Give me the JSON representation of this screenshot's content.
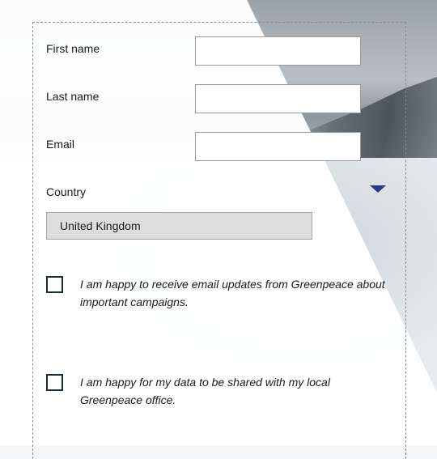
{
  "form": {
    "first_name_label": "First name",
    "last_name_label": "Last name",
    "email_label": "Email",
    "country_label": "Country",
    "country_value": "United Kingdom",
    "consent_email": " I am happy to receive email updates from Greenpeace about important campaigns.",
    "consent_share": "I am happy for my data to be shared with my local Greenpeace office."
  },
  "colors": {
    "accent": "#2b3a8c",
    "checkbox_border": "#1b2a3f",
    "select_bg": "#dedede"
  },
  "icons": {
    "country_dropdown": "chevron-down-icon"
  }
}
